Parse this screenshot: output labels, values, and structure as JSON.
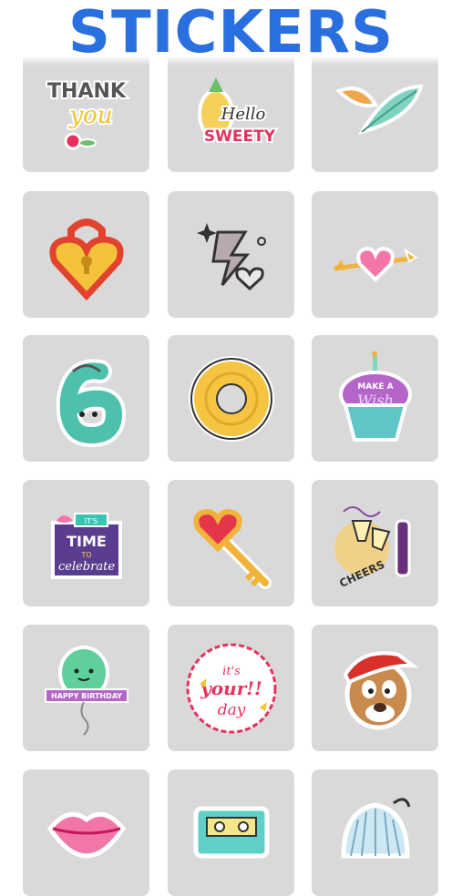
{
  "header": {
    "title": "STICKERS"
  },
  "stickers": [
    {
      "name": "thank-you-sticker",
      "text1": "THANK",
      "text2": "you"
    },
    {
      "name": "hello-sweety-sticker",
      "text1": "Hello",
      "text2": "SWEETY"
    },
    {
      "name": "feather-sticker"
    },
    {
      "name": "heart-lock-sticker"
    },
    {
      "name": "lightning-heart-sticker"
    },
    {
      "name": "heart-arrow-sticker"
    },
    {
      "name": "number-six-sticker"
    },
    {
      "name": "donut-sticker"
    },
    {
      "name": "make-a-wish-cupcake-sticker",
      "text1": "MAKE A",
      "text2": "Wish"
    },
    {
      "name": "time-to-celebrate-sticker",
      "text1": "IT'S",
      "text2": "TIME",
      "text3": "TO",
      "text4": "celebrate"
    },
    {
      "name": "heart-key-sticker"
    },
    {
      "name": "cheers-sticker",
      "text1": "CHEERS"
    },
    {
      "name": "happy-birthday-balloon-sticker",
      "text1": "HAPPY BIRTHDAY"
    },
    {
      "name": "its-your-day-sticker",
      "text1": "it's",
      "text2": "your!!",
      "text3": "day"
    },
    {
      "name": "cartoon-cap-character-sticker"
    },
    {
      "name": "lips-sticker"
    },
    {
      "name": "cassette-sticker"
    },
    {
      "name": "shell-sticker"
    }
  ]
}
